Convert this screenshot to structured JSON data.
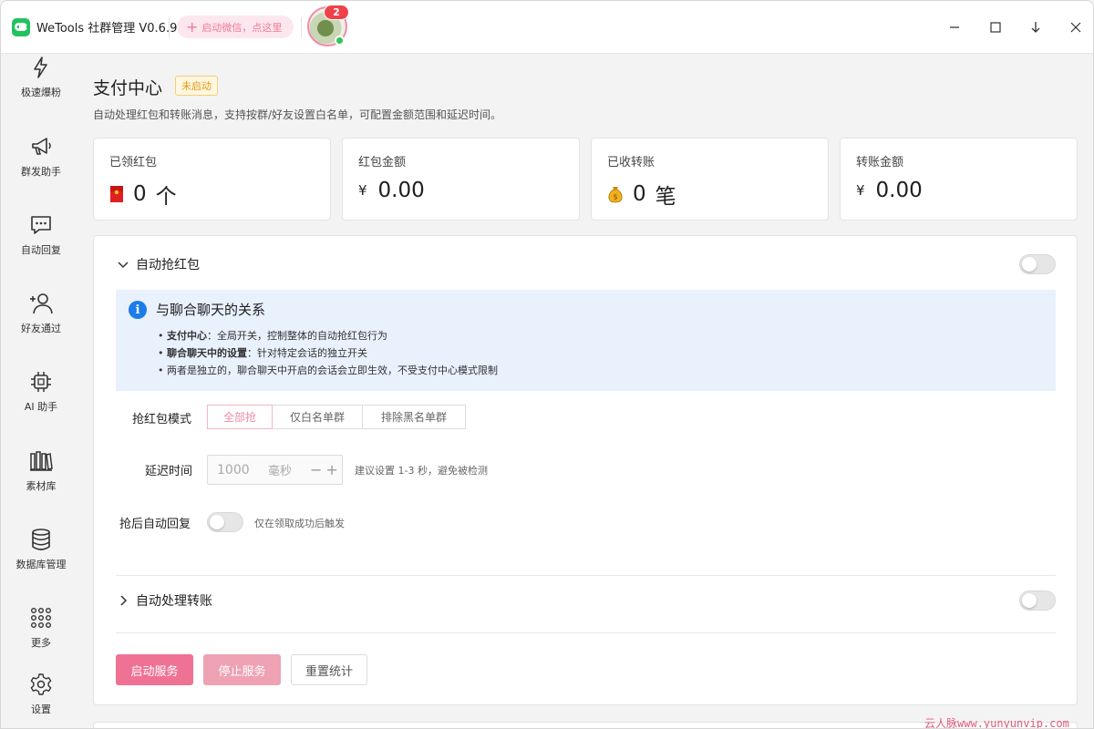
{
  "app": {
    "title": "WeTools 社群管理 V0.6.9",
    "launch_wechat": "启动微信，点这里",
    "avatar_badge": "2"
  },
  "sidebar": {
    "items": [
      {
        "label": "极速爆粉",
        "icon": "lightning-icon"
      },
      {
        "label": "群发助手",
        "icon": "megaphone-icon"
      },
      {
        "label": "自动回复",
        "icon": "chat-bubble-icon"
      },
      {
        "label": "好友通过",
        "icon": "add-user-icon"
      },
      {
        "label": "AI 助手",
        "icon": "chip-icon"
      },
      {
        "label": "素材库",
        "icon": "library-icon"
      },
      {
        "label": "数据库管理",
        "icon": "database-icon"
      },
      {
        "label": "更多",
        "icon": "grid-icon"
      },
      {
        "label": "设置",
        "icon": "gear-icon"
      }
    ]
  },
  "page": {
    "title": "支付中心",
    "status": "未启动",
    "description": "自动处理红包和转账消息，支持按群/好友设置白名单，可配置金额范围和延迟时间。"
  },
  "stats": [
    {
      "label": "已领红包",
      "value": "0",
      "unit": "个",
      "icon": "red-envelope-icon"
    },
    {
      "label": "红包金额",
      "prefix": "¥",
      "value": "0.00"
    },
    {
      "label": "已收转账",
      "value": "0",
      "unit": "笔",
      "icon": "money-bag-icon"
    },
    {
      "label": "转账金额",
      "prefix": "¥",
      "value": "0.00"
    }
  ],
  "red_packet": {
    "section_title": "自动抢红包",
    "enabled": false,
    "info": {
      "title": "与聊合聊天的关系",
      "lines": [
        {
          "bold": "支付中心",
          "text": "：全局开关，控制整体的自动抢红包行为"
        },
        {
          "bold": "聊合聊天中的设置",
          "text": "：针对特定会话的独立开关"
        },
        {
          "bold": "",
          "text": "两者是独立的，聊合聊天中开启的会话会立即生效，不受支付中心模式限制"
        }
      ]
    },
    "mode_label": "抢红包模式",
    "modes": [
      "全部抢",
      "仅白名单群",
      "排除黑名单群"
    ],
    "selected_mode": "全部抢",
    "delay_label": "延迟时间",
    "delay_value": "1000",
    "delay_unit": "毫秒",
    "delay_hint": "建议设置 1-3 秒，避免被检测",
    "auto_reply_label": "抢后自动回复",
    "auto_reply_enabled": false,
    "auto_reply_hint": "仅在领取成功后触发"
  },
  "transfer": {
    "section_title": "自动处理转账",
    "enabled": false
  },
  "actions": {
    "start": "启动服务",
    "stop": "停止服务",
    "reset": "重置统计"
  },
  "watermark": "云人脉www.yunyunvip.com",
  "colors": {
    "accent": "#ef7294",
    "accent_light": "#eea2b4",
    "info_bg": "#e8f1fc",
    "status_warning": "#e09a17"
  }
}
